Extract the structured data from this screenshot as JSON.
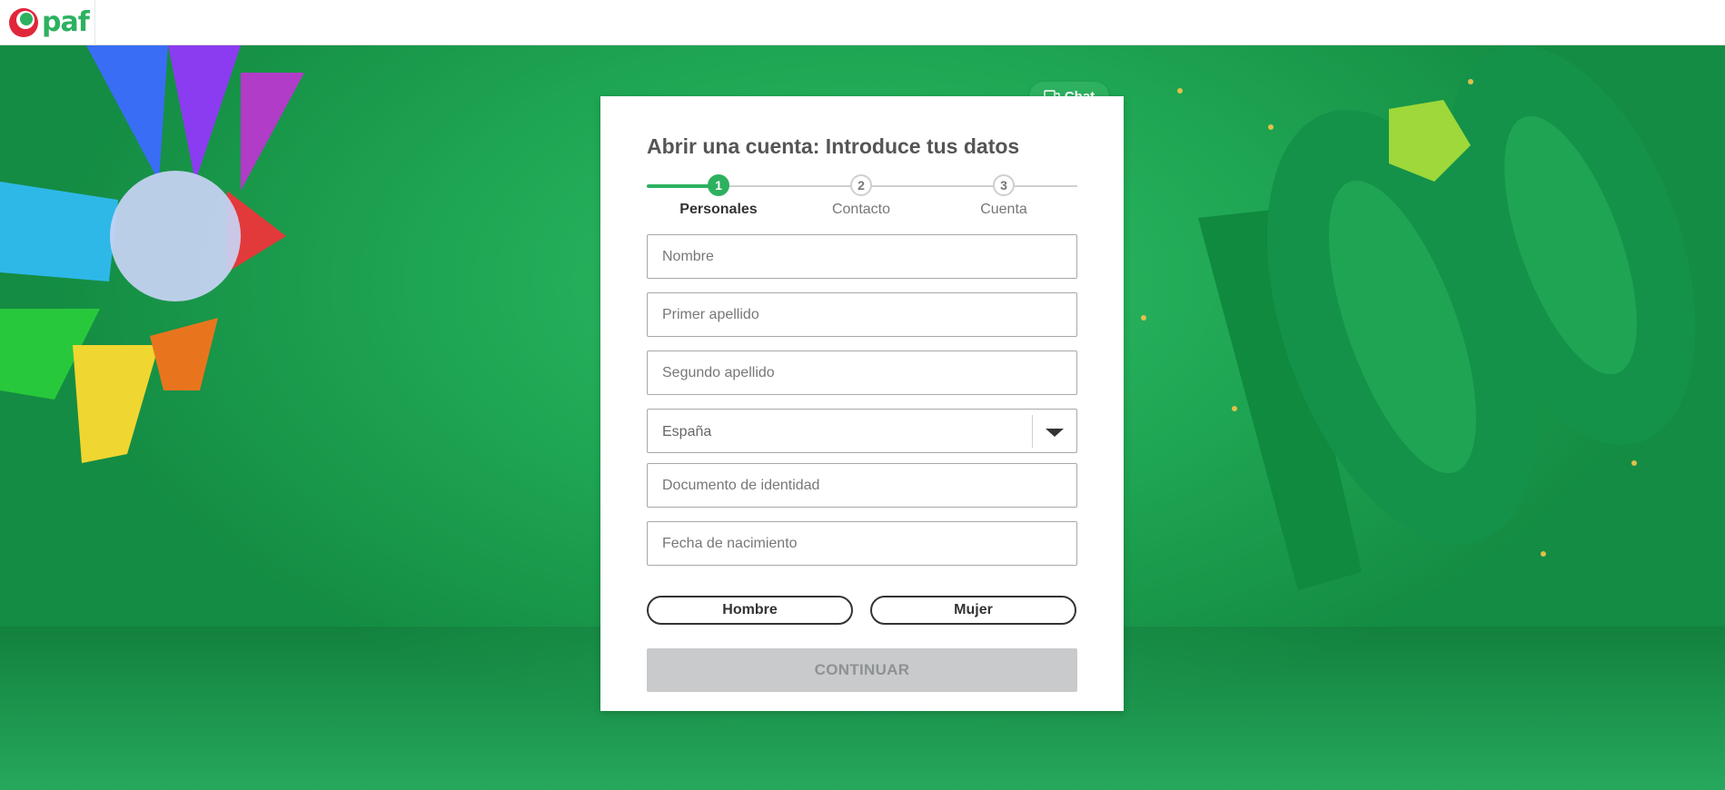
{
  "brand": {
    "name": "paf",
    "color": "#2db160"
  },
  "chat": {
    "label": "Chat",
    "icon": "chat-bubbles-icon"
  },
  "form": {
    "title": "Abrir una cuenta: Introduce tus datos",
    "steps": [
      {
        "number": "1",
        "label": "Personales",
        "active": true
      },
      {
        "number": "2",
        "label": "Contacto",
        "active": false
      },
      {
        "number": "3",
        "label": "Cuenta",
        "active": false
      }
    ],
    "fields": {
      "first_name": {
        "placeholder": "Nombre",
        "value": ""
      },
      "last_name_1": {
        "placeholder": "Primer apellido",
        "value": ""
      },
      "last_name_2": {
        "placeholder": "Segundo apellido",
        "value": ""
      },
      "country": {
        "selected": "España"
      },
      "id_document": {
        "placeholder": "Documento de identidad",
        "value": ""
      },
      "birth_date": {
        "placeholder": "Fecha de nacimiento",
        "value": ""
      }
    },
    "gender": {
      "male": "Hombre",
      "female": "Mujer"
    },
    "continue_label": "CONTINUAR"
  },
  "colors": {
    "accent": "#2db160",
    "background": "#1fa453",
    "disabled": "#c8cacb"
  }
}
